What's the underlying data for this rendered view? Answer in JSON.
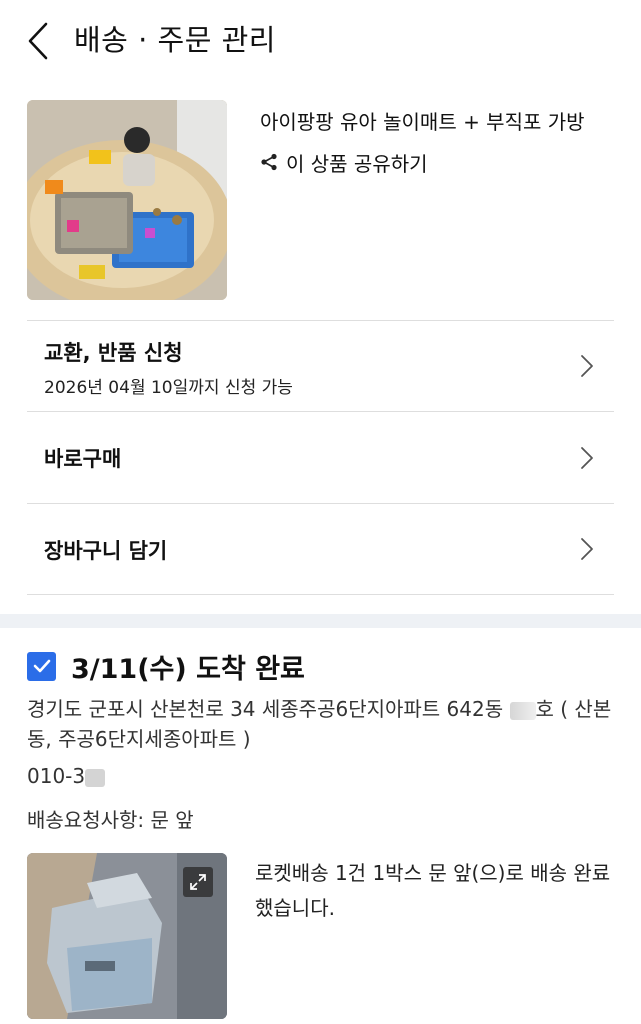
{
  "header": {
    "title": "배송 · 주문 관리"
  },
  "product": {
    "name": "아이팡팡 유아 놀이매트 + 부직포 가방",
    "share_label": "이 상품 공유하기"
  },
  "menu": {
    "items": [
      {
        "label": "교환, 반품 신청",
        "sub": "2026년 04월 10일까지 신청 가능"
      },
      {
        "label": "바로구매"
      },
      {
        "label": "장바구니 담기"
      }
    ]
  },
  "delivery": {
    "checked": true,
    "status": "3/11(수) 도착 완료",
    "address_part1": "경기도 군포시 산본천로 34 세종주공6단지아파트 642동 ",
    "address_part2": "호 ( 산본동, 주공6단지세종아파트 )",
    "phone": "010-3",
    "request_label": "배송요청사항:",
    "request_value": "문 앞",
    "message": "로켓배송 1건 1박스 문 앞(으)로 배송 완료했습니다."
  },
  "colors": {
    "accent": "#2b6de8",
    "divider": "#dedede",
    "band": "#eef1f5"
  },
  "icons": {
    "back": "chevron-left-icon",
    "share": "share-icon",
    "row": "chevron-right-icon",
    "check": "checkmark-icon",
    "expand": "expand-icon"
  }
}
